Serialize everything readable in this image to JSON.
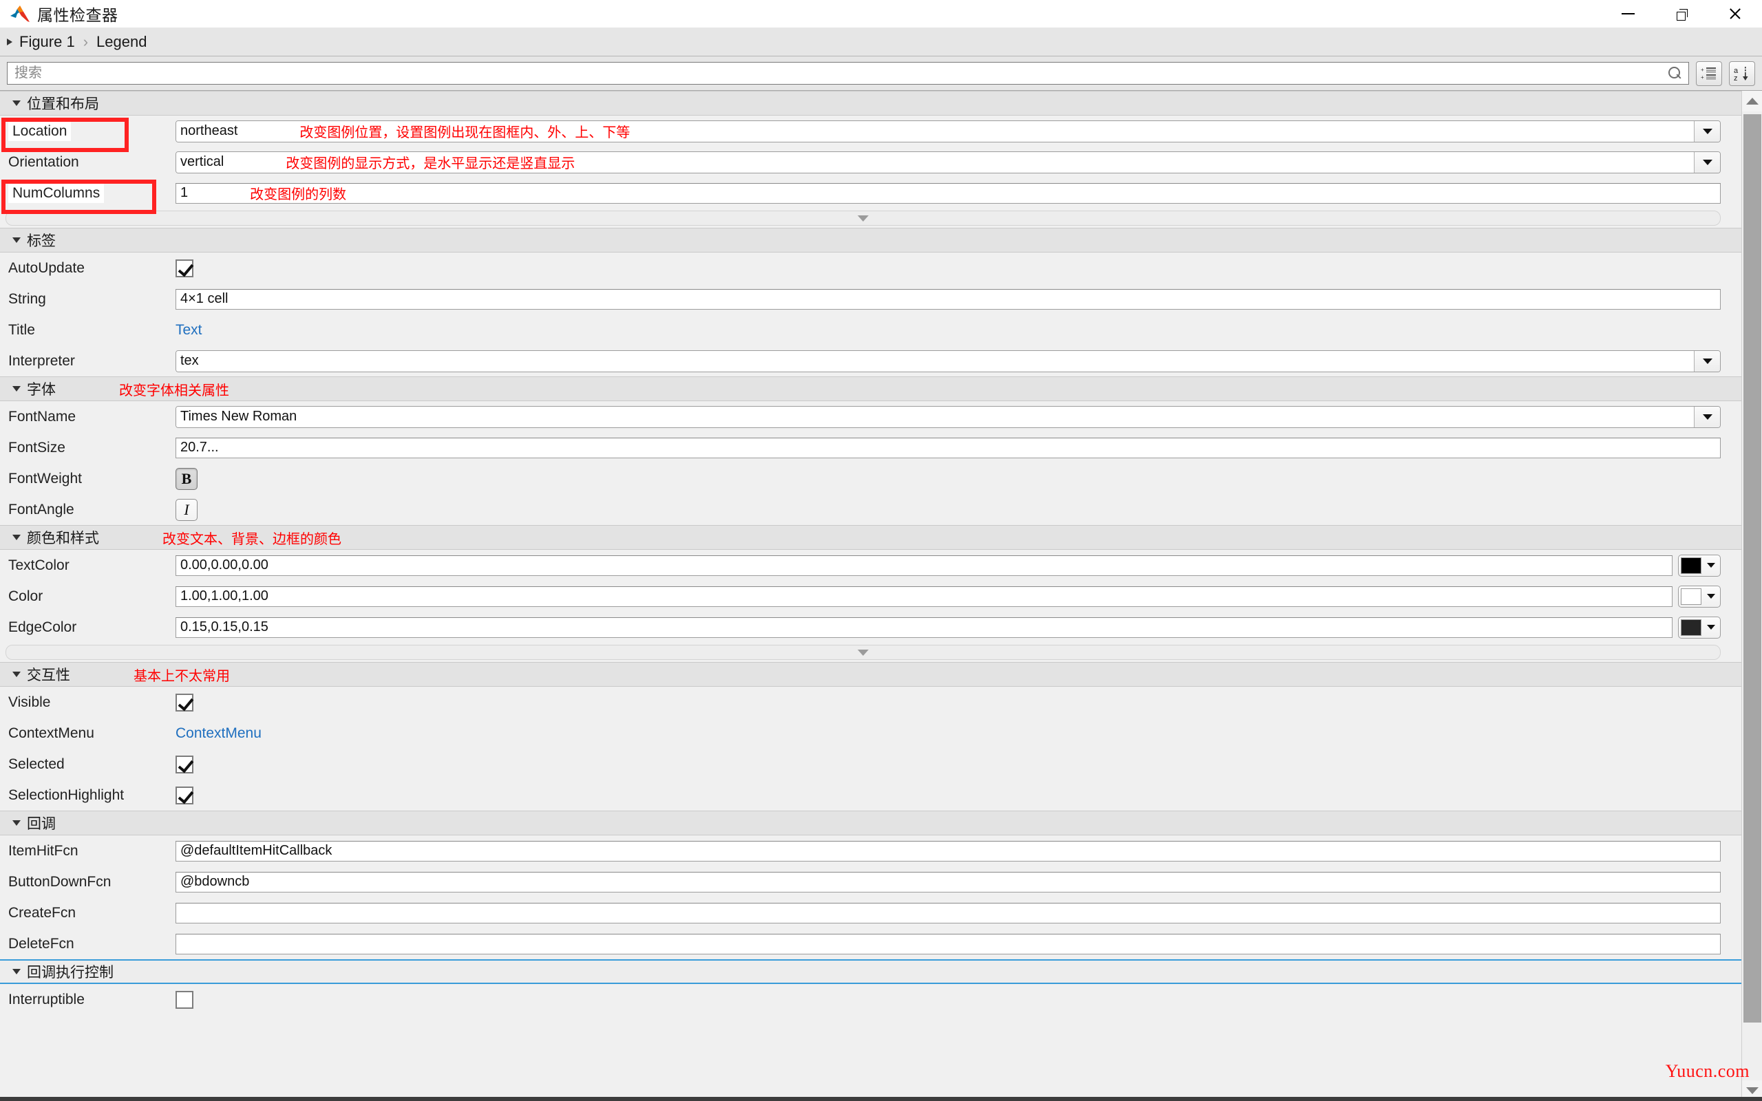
{
  "window": {
    "title": "属性检查器",
    "controls": {
      "minimize": "—",
      "restore": "❐",
      "close": "✕"
    }
  },
  "breadcrumb": {
    "root": "Figure 1",
    "separator": "›",
    "current": "Legend"
  },
  "search": {
    "placeholder": "搜索",
    "value": ""
  },
  "toolbar": {
    "group_icon": "grouped-list-icon",
    "sort_icon": "sort-alpha-icon",
    "search_icon": "search-icon"
  },
  "sections": [
    {
      "id": "layout",
      "label": "位置和布局",
      "note": "",
      "rows": [
        {
          "label": "Location",
          "type": "combo",
          "value": "northeast",
          "note": "改变图例位置，设置图例出现在图框内、外、上、下等",
          "highlight": true
        },
        {
          "label": "Orientation",
          "type": "combo",
          "value": "vertical",
          "note": "改变图例的显示方式，是水平显示还是竖直显示",
          "highlight": false
        },
        {
          "label": "NumColumns",
          "type": "text",
          "value": "1",
          "note": "改变图例的列数",
          "highlight": true
        }
      ],
      "has_more": true
    },
    {
      "id": "labels",
      "label": "标签",
      "note": "",
      "rows": [
        {
          "label": "AutoUpdate",
          "type": "checkbox",
          "checked": true
        },
        {
          "label": "String",
          "type": "text",
          "value": "4×1 cell"
        },
        {
          "label": "Title",
          "type": "link",
          "value": "Text"
        },
        {
          "label": "Interpreter",
          "type": "combo",
          "value": "tex"
        }
      ],
      "has_more": false
    },
    {
      "id": "font",
      "label": "字体",
      "note": "改变字体相关属性",
      "rows": [
        {
          "label": "FontName",
          "type": "combo",
          "value": "Times New Roman"
        },
        {
          "label": "FontSize",
          "type": "text",
          "value": "20.7..."
        },
        {
          "label": "FontWeight",
          "type": "toggle",
          "glyph": "B",
          "pressed": true
        },
        {
          "label": "FontAngle",
          "type": "toggle",
          "glyph": "I",
          "pressed": false
        }
      ],
      "has_more": false
    },
    {
      "id": "colors",
      "label": "颜色和样式",
      "note": "改变文本、背景、边框的颜色",
      "rows": [
        {
          "label": "TextColor",
          "type": "color",
          "value": "0.00,0.00,0.00",
          "swatch": "#000000"
        },
        {
          "label": "Color",
          "type": "color",
          "value": "1.00,1.00,1.00",
          "swatch": "#ffffff"
        },
        {
          "label": "EdgeColor",
          "type": "color",
          "value": "0.15,0.15,0.15",
          "swatch": "#262626"
        }
      ],
      "has_more": true
    },
    {
      "id": "interactivity",
      "label": "交互性",
      "note": "基本上不太常用",
      "rows": [
        {
          "label": "Visible",
          "type": "checkbox",
          "checked": true
        },
        {
          "label": "ContextMenu",
          "type": "link",
          "value": "ContextMenu"
        },
        {
          "label": "Selected",
          "type": "checkbox",
          "checked": true
        },
        {
          "label": "SelectionHighlight",
          "type": "checkbox",
          "checked": true
        }
      ],
      "has_more": false
    },
    {
      "id": "callbacks",
      "label": "回调",
      "note": "",
      "rows": [
        {
          "label": "ItemHitFcn",
          "type": "text",
          "value": "@defaultItemHitCallback"
        },
        {
          "label": "ButtonDownFcn",
          "type": "text",
          "value": "@bdowncb"
        },
        {
          "label": "CreateFcn",
          "type": "text",
          "value": ""
        },
        {
          "label": "DeleteFcn",
          "type": "text",
          "value": ""
        }
      ],
      "has_more": false
    },
    {
      "id": "callback-exec",
      "label": "回调执行控制",
      "note": "",
      "selected": true,
      "rows": [
        {
          "label": "Interruptible",
          "type": "checkbox",
          "checked": false
        }
      ],
      "has_more": false
    }
  ],
  "watermark": "Yuucn.com"
}
